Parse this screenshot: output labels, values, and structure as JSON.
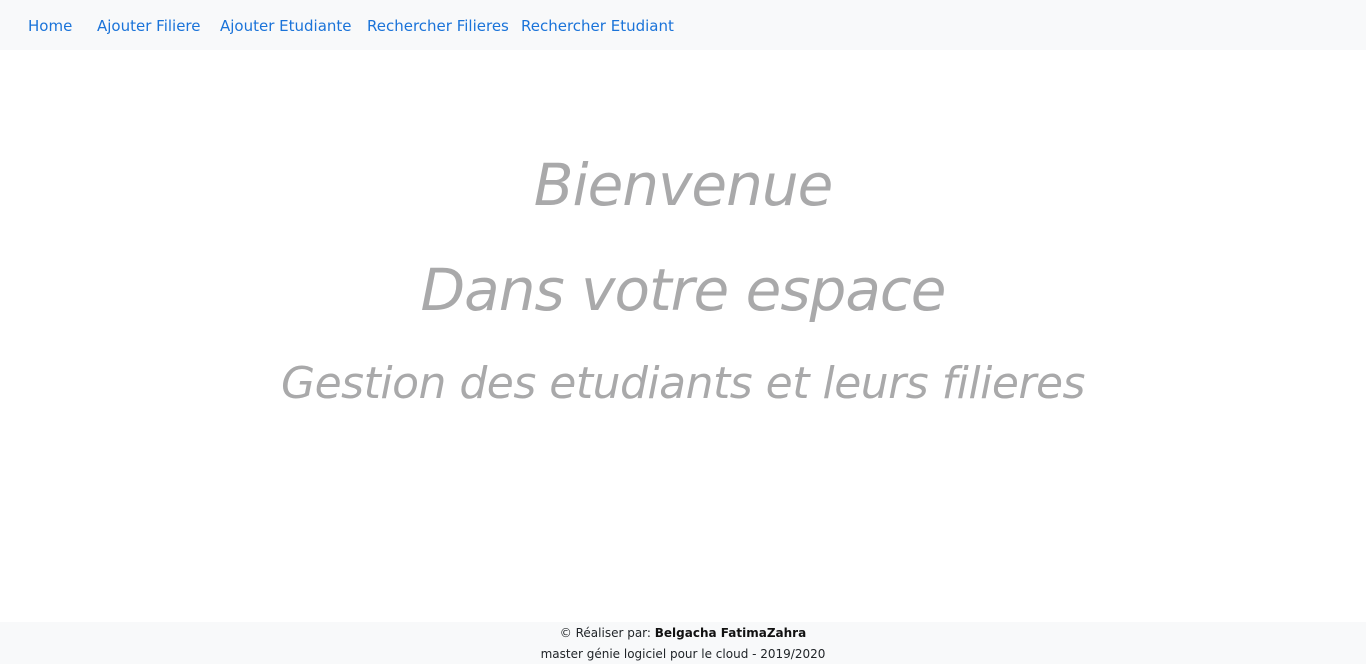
{
  "nav": {
    "items": [
      {
        "label": "Home"
      },
      {
        "label": "Ajouter Filiere"
      },
      {
        "label": "Ajouter Etudiante"
      },
      {
        "label": "Rechercher Filieres"
      },
      {
        "label": "Rechercher Etudiant"
      }
    ]
  },
  "main": {
    "line1": "Bienvenue",
    "line2": "Dans votre espace",
    "line3": "Gestion des etudiants et leurs filieres"
  },
  "footer": {
    "copyright_prefix": "© Réaliser par:",
    "author": "Belgacha FatimaZahra",
    "subtitle": "master génie logiciel pour le cloud - 2019/2020"
  },
  "colors": {
    "link": "#1a73d9",
    "nav_background": "#f8f9fa",
    "welcome_text": "#a9a9aa"
  }
}
